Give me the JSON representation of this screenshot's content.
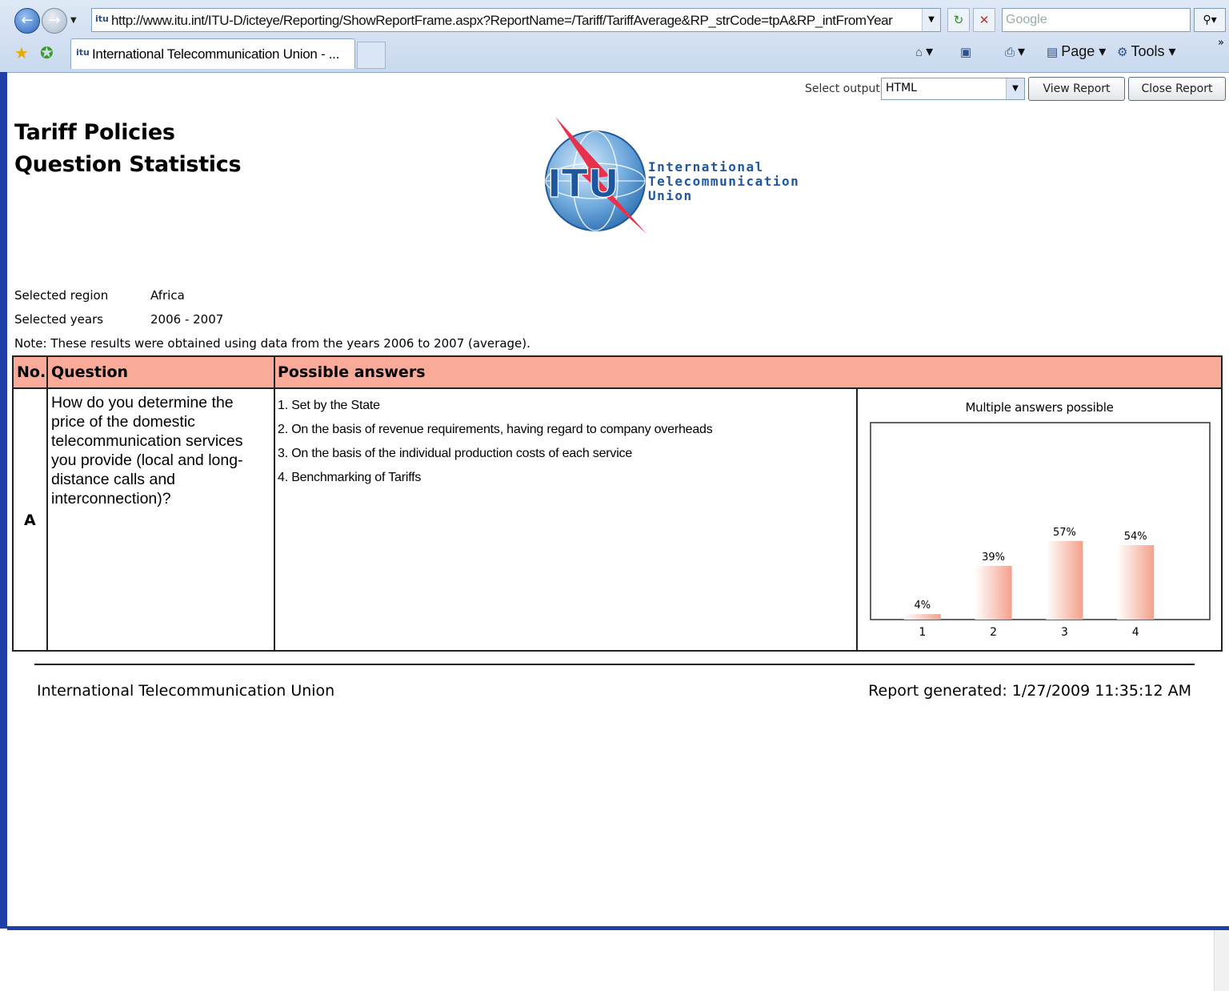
{
  "browser": {
    "address_url": "http://www.itu.int/ITU-D/icteye/Reporting/ShowReportFrame.aspx?ReportName=/Tariff/TariffAverage&RP_strCode=tpA&RP_intFromYear",
    "search_placeholder": "Google",
    "tab_title": "International Telecommunication Union - ...",
    "commands": {
      "page": "Page",
      "tools": "Tools"
    }
  },
  "report_controls": {
    "output_label": "Select output",
    "output_value": "HTML",
    "view_button": "View Report",
    "close_button": "Close Report"
  },
  "header": {
    "title_line1": "Tariff Policies",
    "title_line2": "Question Statistics",
    "logo_text": {
      "short": "ITU",
      "line1": "International",
      "line2": "Telecommunication",
      "line3": "Union"
    }
  },
  "filters": {
    "region_label": "Selected region",
    "region_value": "Africa",
    "years_label": "Selected years",
    "years_value": "2006 - 2007",
    "note": "Note: These results were obtained using data from the years 2006 to 2007 (average)."
  },
  "table": {
    "headers": {
      "no": "No.",
      "question": "Question",
      "answers": "Possible answers"
    },
    "row": {
      "no": "A",
      "question": "How do you determine the price of the domestic telecommunication services you provide (local and long-distance calls and interconnection)?",
      "answers": [
        "1. Set by the State",
        "2. On the basis of revenue requirements, having regard to company overheads",
        "3. On the basis of the individual production costs of each service",
        "4. Benchmarking of Tariffs"
      ]
    }
  },
  "chart_data": {
    "type": "bar",
    "title": "Multiple answers possible",
    "categories": [
      "1",
      "2",
      "3",
      "4"
    ],
    "values": [
      4,
      39,
      57,
      54
    ],
    "data_labels": [
      "4%",
      "39%",
      "57%",
      "54%"
    ],
    "unit": "%",
    "ylim": [
      0,
      100
    ],
    "grid": false,
    "bar_color": "#f4a08a"
  },
  "footer": {
    "org": "International Telecommunication Union",
    "generated": "Report generated: 1/27/2009 11:35:12 AM"
  }
}
